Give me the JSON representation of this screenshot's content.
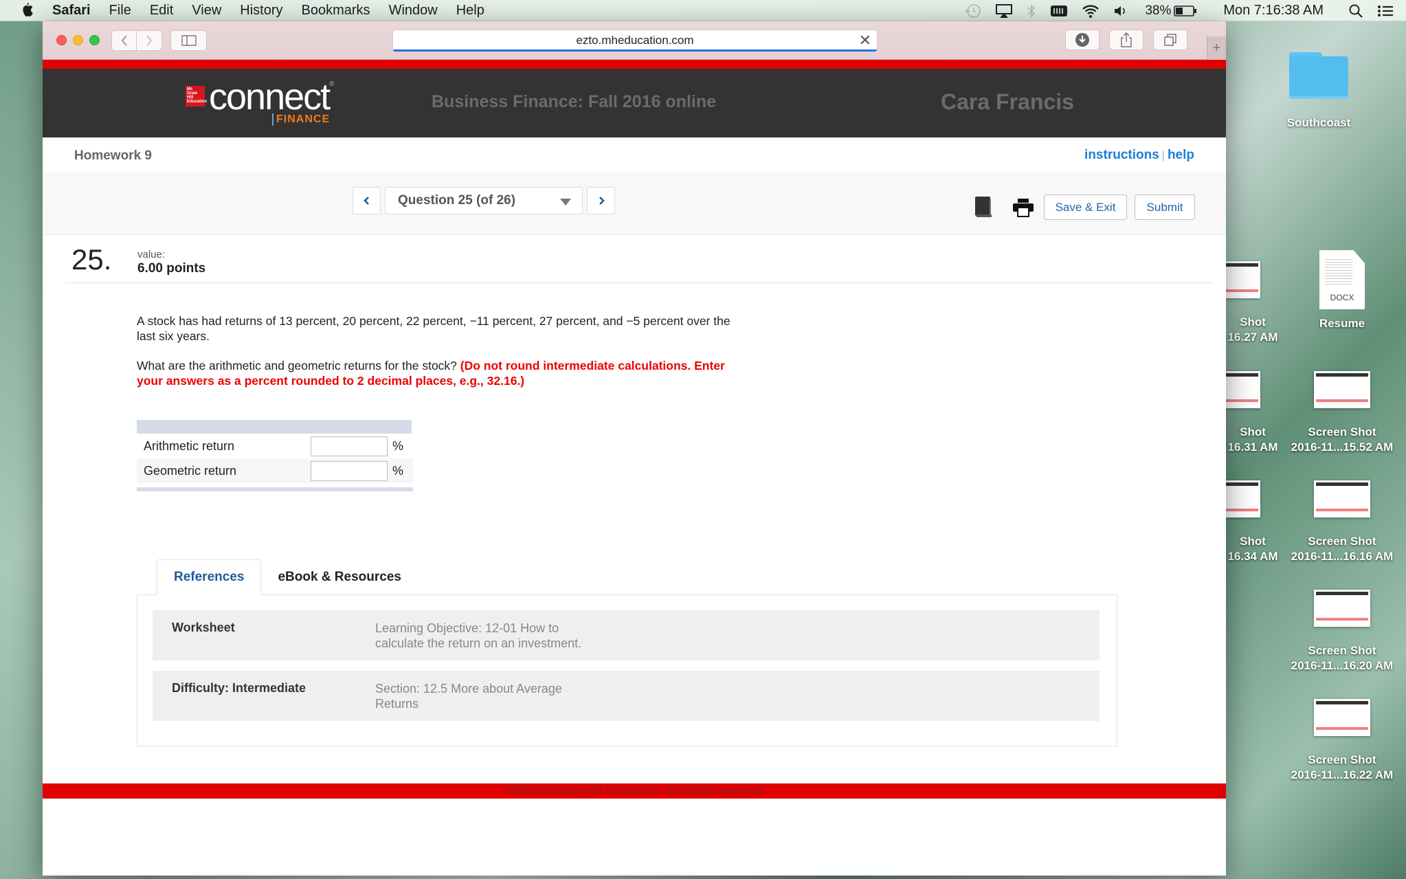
{
  "menubar": {
    "app_name": "Safari",
    "items": [
      "File",
      "Edit",
      "View",
      "History",
      "Bookmarks",
      "Window",
      "Help"
    ],
    "status": {
      "battery_percent": "38%",
      "clock": "Mon 7:16:38 AM"
    }
  },
  "browser": {
    "url": "ezto.mheducation.com"
  },
  "header": {
    "logo_word": "connect",
    "logo_badge": "Mc Graw Hill Education",
    "logo_subject": "FINANCE",
    "course_title": "Business Finance: Fall 2016 online",
    "student_name": "Cara Francis"
  },
  "assignment": {
    "title": "Homework 9",
    "links": {
      "instructions": "instructions",
      "separator": "|",
      "help": "help"
    }
  },
  "question_nav": {
    "current_label": "Question 25 (of 26)",
    "current": 25,
    "total": 26,
    "save_exit_label": "Save & Exit",
    "submit_label": "Submit"
  },
  "question": {
    "number": "25.",
    "value_label": "value:",
    "points": "6.00 points",
    "text": "A stock has had returns of 13 percent, 20 percent, 22 percent, −11 percent, 27 percent, and −5 percent over the last six years.",
    "prompt": "What are the arithmetic and geometric returns for the stock?",
    "instruction": "(Do not round intermediate calculations. Enter your answers as a percent rounded to 2 decimal places, e.g., 32.16.)",
    "answers": [
      {
        "label": "Arithmetic return",
        "value": "",
        "unit": "%"
      },
      {
        "label": "Geometric return",
        "value": "",
        "unit": "%"
      }
    ]
  },
  "resources": {
    "tabs": [
      {
        "label": "References",
        "active": true
      },
      {
        "label": "eBook & Resources",
        "active": false
      }
    ],
    "rows": [
      {
        "key": "Worksheet",
        "value": "Learning Objective: 12-01 How to calculate the return on an investment."
      },
      {
        "key": "Difficulty: Intermediate",
        "value": "Section: 12.5 More about Average Returns"
      }
    ]
  },
  "footer": {
    "copyright": "©2016 McGraw-Hill Education. All rights reserved."
  },
  "desktop": {
    "icons": [
      {
        "label": "Southcoast",
        "type": "folder"
      },
      {
        "label": "Resume",
        "type": "docx",
        "badge": "DOCX"
      },
      {
        "label_line1": "Screen Shot",
        "label_line2": "2016-11...15.52 AM"
      },
      {
        "label_line1": "Screen Shot",
        "label_line2": "2016-11...16.16 AM"
      },
      {
        "label_line1": "Screen Shot",
        "label_line2": "2016-11...16.20 AM"
      },
      {
        "label_line1": "Screen Shot",
        "label_line2": "2016-11...16.22 AM"
      },
      {
        "label_line1": "Shot",
        "label_line2": "16.27 AM"
      },
      {
        "label_line1": "Shot",
        "label_line2": "16.31 AM"
      },
      {
        "label_line1": "Shot",
        "label_line2": "16.34 AM"
      }
    ]
  }
}
